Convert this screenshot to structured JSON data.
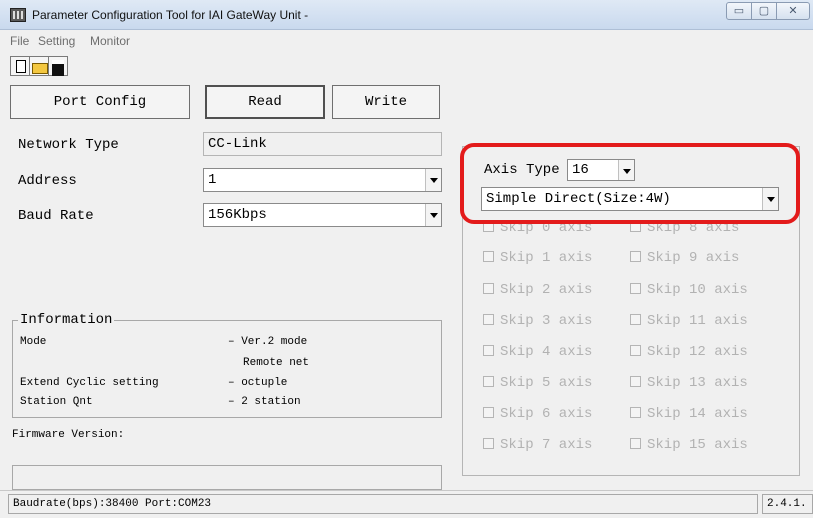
{
  "window": {
    "title": "Parameter Configuration Tool for IAI GateWay Unit -",
    "controls": {
      "minimize": "▭",
      "maximize": "▢",
      "close": "✕"
    }
  },
  "menu": [
    "File",
    "Setting",
    "Monitor"
  ],
  "toolbar": {
    "icons": [
      "new-file-icon",
      "open-folder-icon",
      "save-disk-icon"
    ]
  },
  "buttons": {
    "port_config": "Port Config",
    "read": "Read",
    "write": "Write"
  },
  "fields": {
    "network_type": {
      "label": "Network Type",
      "value": "CC-Link"
    },
    "address": {
      "label": "Address",
      "value": "1"
    },
    "baud_rate": {
      "label": "Baud Rate",
      "value": "156Kbps"
    }
  },
  "information": {
    "title": "Information",
    "rows": [
      {
        "label": "Mode",
        "value": "– Ver.2 mode"
      },
      {
        "label": "",
        "value": "Remote net"
      },
      {
        "label": "Extend Cyclic setting",
        "value": "– octuple"
      },
      {
        "label": "Station Qnt",
        "value": "– 2 station"
      }
    ]
  },
  "firmware": {
    "label": "Firmware Version:",
    "value": ""
  },
  "axis": {
    "type_label": "Axis Type",
    "type_value": "16",
    "mode_value": "Simple Direct(Size:4W)",
    "skip_left": [
      "Skip 0 axis",
      "Skip 1 axis",
      "Skip 2 axis",
      "Skip 3 axis",
      "Skip 4 axis",
      "Skip 5 axis",
      "Skip 6 axis",
      "Skip 7 axis"
    ],
    "skip_right": [
      "Skip 8 axis",
      "Skip 9 axis",
      "Skip 10 axis",
      "Skip 11 axis",
      "Skip 12 axis",
      "Skip 13 axis",
      "Skip 14 axis",
      "Skip 15 axis"
    ]
  },
  "status": {
    "main": "Baudrate(bps):38400   Port:COM23",
    "version": "2.4.1."
  },
  "colors": {
    "highlight": "#e31b1b",
    "disabled_text": "#b2b2b2",
    "window_bg": "#f0f0f0"
  }
}
